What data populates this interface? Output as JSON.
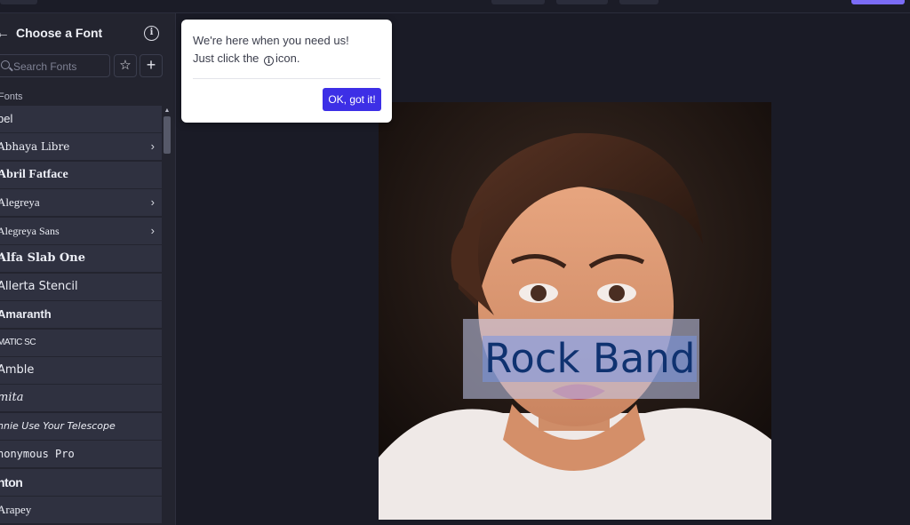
{
  "colors": {
    "accent": "#3d2fe6",
    "sidebar_bg": "#23242f",
    "canvas_bg": "#1a1b26",
    "text_overlay": "#0f3270"
  },
  "panel": {
    "title": "Choose a Font",
    "back_icon": "arrow-left-icon",
    "info_icon": "info-icon"
  },
  "search": {
    "placeholder": "Search Fonts",
    "value": ""
  },
  "toolbar": {
    "favorite_icon": "star-icon",
    "add_icon": "plus-icon"
  },
  "section_label": "Fonts",
  "fonts": [
    {
      "label": "bel",
      "chevron": ""
    },
    {
      "label": "Abhaya Libre",
      "chevron": "›"
    },
    {
      "label": "Abril Fatface",
      "chevron": ""
    },
    {
      "label": "Alegreya",
      "chevron": "›"
    },
    {
      "label": "Alegreya Sans",
      "chevron": "›"
    },
    {
      "label": "Alfa Slab One",
      "chevron": ""
    },
    {
      "label": "Allerta Stencil",
      "chevron": ""
    },
    {
      "label": "Amaranth",
      "chevron": ""
    },
    {
      "label": "MATIC SC",
      "chevron": ""
    },
    {
      "label": "Amble",
      "chevron": ""
    },
    {
      "label": "mita",
      "chevron": ""
    },
    {
      "label": "nnie Use Your Telescope",
      "chevron": ""
    },
    {
      "label": "nonymous Pro",
      "chevron": ""
    },
    {
      "label": "nton",
      "chevron": ""
    },
    {
      "label": "Arapey",
      "chevron": ""
    }
  ],
  "tooltip": {
    "line1": "We're here when you need us!",
    "line2_before": "Just click the",
    "line2_after": "icon.",
    "ok_label": "OK, got it!"
  },
  "canvas": {
    "text_layer": "Rock Band"
  }
}
